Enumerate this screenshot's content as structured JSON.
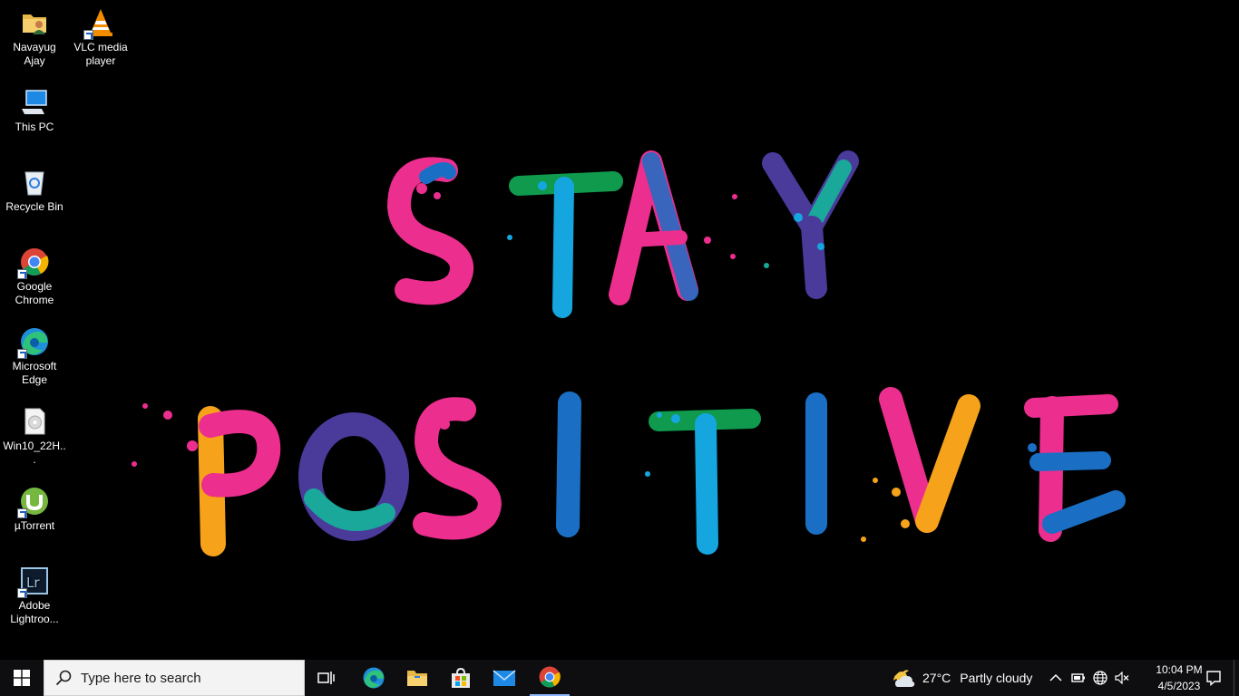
{
  "desktop": {
    "wallpaper_text": [
      "STAY",
      "POSITIVE"
    ],
    "icons": [
      {
        "name": "folder-icon",
        "label": "Navayug Ajay"
      },
      {
        "name": "vlc-icon",
        "label": "VLC media player"
      },
      {
        "name": "this-pc-icon",
        "label": "This PC"
      },
      {
        "name": "recycle-bin-icon",
        "label": "Recycle Bin"
      },
      {
        "name": "chrome-icon",
        "label": "Google Chrome"
      },
      {
        "name": "edge-icon",
        "label": "Microsoft Edge"
      },
      {
        "name": "disc-image-icon",
        "label": "Win10_22H..."
      },
      {
        "name": "utorrent-icon",
        "label": "µTorrent"
      },
      {
        "name": "lightroom-icon",
        "label": "Adobe Lightroo..."
      }
    ]
  },
  "taskbar": {
    "search_placeholder": "Type here to search",
    "pinned": [
      "task-view-icon",
      "edge-icon",
      "file-explorer-icon",
      "store-icon",
      "mail-icon",
      "chrome-icon"
    ],
    "weather": {
      "temp": "27°C",
      "condition": "Partly cloudy"
    },
    "tray": [
      "chevron-up-icon",
      "battery-icon",
      "network-globe-icon",
      "speaker-muted-icon"
    ],
    "clock": {
      "time": "10:04 PM",
      "date": "4/5/2023"
    }
  },
  "colors": {
    "taskbar_bg": "#0e0e10",
    "search_bg": "#f3f3f3",
    "pink": "#ec2e8e",
    "blue": "#1a6fc4",
    "cyan": "#15a6df",
    "green": "#0f9a4e",
    "purple": "#4a3a9a",
    "orange": "#f6a21a",
    "teal": "#1aa89a"
  }
}
